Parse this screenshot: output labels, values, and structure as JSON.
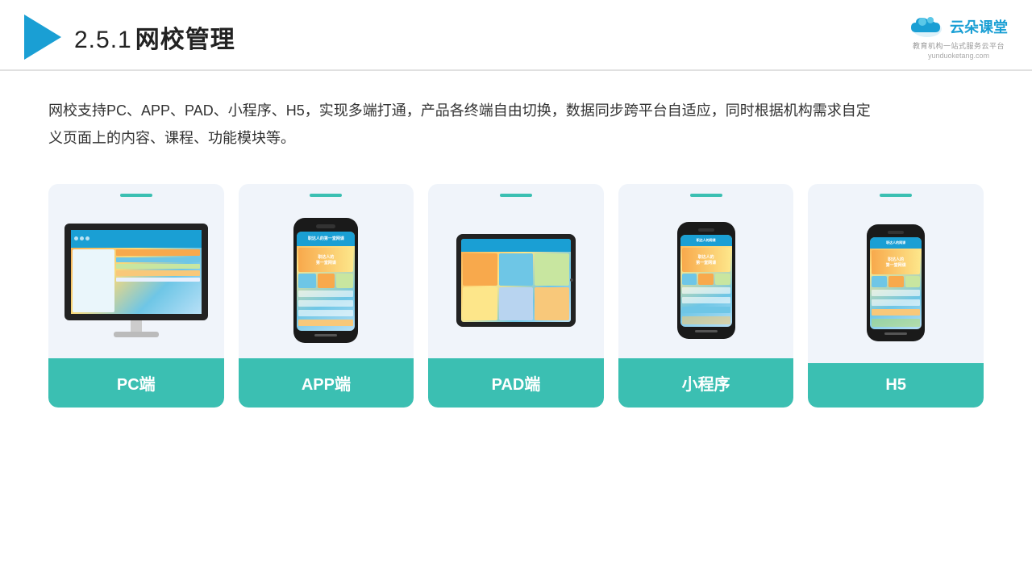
{
  "header": {
    "section": "2.5.1",
    "title": "网校管理",
    "logo": {
      "name": "云朵课堂",
      "url": "yunduoketang.com",
      "subtitle1": "教育机构一站",
      "subtitle2": "式服务云平台"
    }
  },
  "description": "网校支持PC、APP、PAD、小程序、H5，实现多端打通，产品各终端自由切换，数据同步跨平台自适应，同时根据机构需求自定义页面上的内容、课程、功能模块等。",
  "cards": [
    {
      "id": "pc",
      "label": "PC端"
    },
    {
      "id": "app",
      "label": "APP端"
    },
    {
      "id": "pad",
      "label": "PAD端"
    },
    {
      "id": "miniprogram",
      "label": "小程序"
    },
    {
      "id": "h5",
      "label": "H5"
    }
  ],
  "colors": {
    "teal": "#3bbfb2",
    "blue": "#1a9fd4",
    "bg_card": "#f0f4fa",
    "text_dark": "#222",
    "text_body": "#333"
  }
}
